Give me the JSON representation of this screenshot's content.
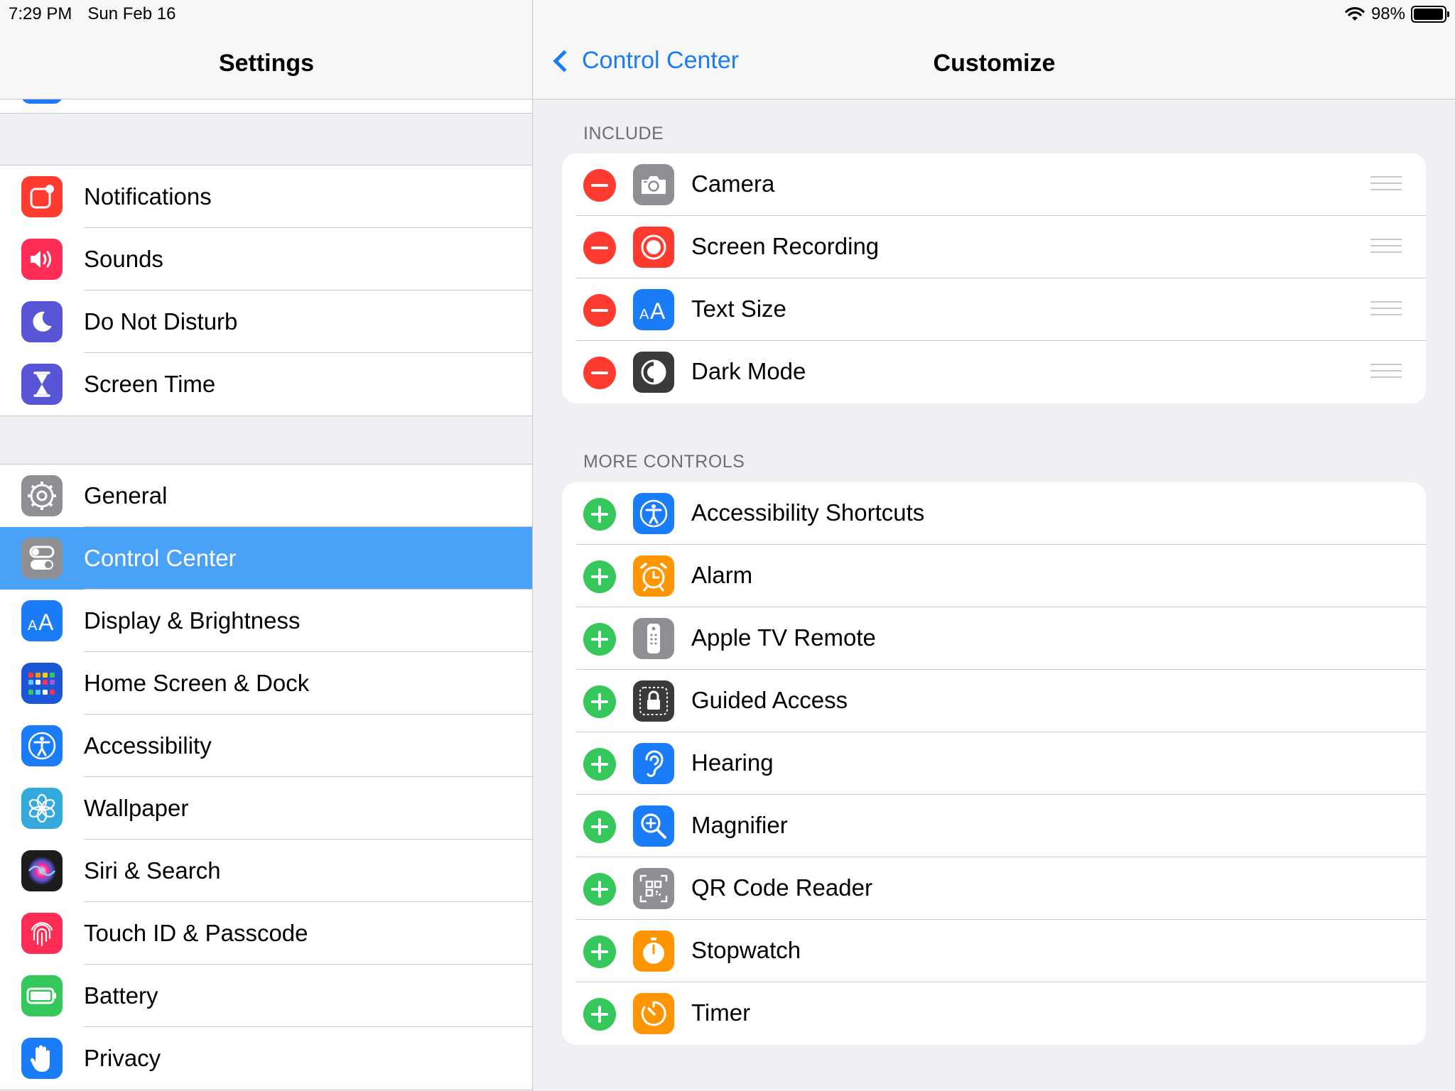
{
  "status": {
    "time": "7:29 PM",
    "date": "Sun Feb 16",
    "battery": "98%",
    "battery_level": 0.98
  },
  "sidebar": {
    "title": "Settings",
    "group1": [
      {
        "label": "Notifications",
        "icon": "notifications-icon",
        "color": "#ff3b30"
      },
      {
        "label": "Sounds",
        "icon": "sounds-icon",
        "color": "#ff2d55"
      },
      {
        "label": "Do Not Disturb",
        "icon": "moon-icon",
        "color": "#5856d6"
      },
      {
        "label": "Screen Time",
        "icon": "hourglass-icon",
        "color": "#5856d6"
      }
    ],
    "group2": [
      {
        "label": "General",
        "icon": "gear-icon",
        "color": "#8e8e93"
      },
      {
        "label": "Control Center",
        "icon": "toggles-icon",
        "color": "#8e8e93",
        "selected": true
      },
      {
        "label": "Display & Brightness",
        "icon": "text-size-icon",
        "color": "#1a7cf7"
      },
      {
        "label": "Home Screen & Dock",
        "icon": "home-grid-icon",
        "color": "#1a56d6"
      },
      {
        "label": "Accessibility",
        "icon": "accessibility-icon",
        "color": "#1a7cf7"
      },
      {
        "label": "Wallpaper",
        "icon": "flower-icon",
        "color": "#34aadc"
      },
      {
        "label": "Siri & Search",
        "icon": "siri-icon",
        "color": "#1c1c1e"
      },
      {
        "label": "Touch ID & Passcode",
        "icon": "fingerprint-icon",
        "color": "#ff2d55"
      },
      {
        "label": "Battery",
        "icon": "battery-icon",
        "color": "#34c759"
      },
      {
        "label": "Privacy",
        "icon": "hand-icon",
        "color": "#1a7cf7"
      }
    ]
  },
  "detail": {
    "back_label": "Control Center",
    "title": "Customize",
    "include_header": "INCLUDE",
    "include": [
      {
        "label": "Camera",
        "icon": "camera-icon",
        "color": "#8e8e93"
      },
      {
        "label": "Screen Recording",
        "icon": "record-icon",
        "color": "#ff3b30"
      },
      {
        "label": "Text Size",
        "icon": "text-size-icon",
        "color": "#1a7cf7"
      },
      {
        "label": "Dark Mode",
        "icon": "dark-mode-icon",
        "color": "#3a3a3c"
      }
    ],
    "more_header": "MORE CONTROLS",
    "more": [
      {
        "label": "Accessibility Shortcuts",
        "icon": "accessibility-icon",
        "color": "#1a7cf7"
      },
      {
        "label": "Alarm",
        "icon": "alarm-icon",
        "color": "#ff9500"
      },
      {
        "label": "Apple TV Remote",
        "icon": "remote-icon",
        "color": "#8e8e93"
      },
      {
        "label": "Guided Access",
        "icon": "lock-icon",
        "color": "#3a3a3c"
      },
      {
        "label": "Hearing",
        "icon": "ear-icon",
        "color": "#1a7cf7"
      },
      {
        "label": "Magnifier",
        "icon": "magnifier-icon",
        "color": "#1a7cf7"
      },
      {
        "label": "QR Code Reader",
        "icon": "qr-code-icon",
        "color": "#8e8e93"
      },
      {
        "label": "Stopwatch",
        "icon": "stopwatch-icon",
        "color": "#ff9500"
      },
      {
        "label": "Timer",
        "icon": "timer-icon",
        "color": "#ff9500"
      }
    ]
  }
}
